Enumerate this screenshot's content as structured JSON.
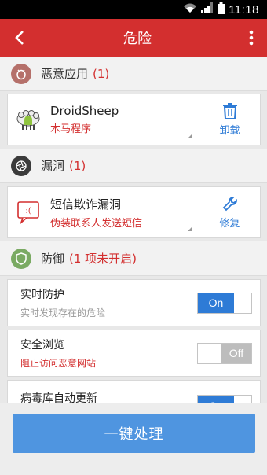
{
  "status_bar": {
    "time": "11:18"
  },
  "app_bar": {
    "title": "危险"
  },
  "malware": {
    "header_label": "恶意应用",
    "header_count": "(1)",
    "item": {
      "name": "DroidSheep",
      "type": "木马程序",
      "action_label": "卸载"
    }
  },
  "vuln": {
    "header_label": "漏洞",
    "header_count": "(1)",
    "item": {
      "name": "短信欺诈漏洞",
      "desc": "伪装联系人发送短信",
      "action_label": "修复"
    }
  },
  "defense": {
    "header_label": "防御",
    "header_count": "(1 项未开启)",
    "settings": [
      {
        "title": "实时防护",
        "desc": "实时发现存在的危险",
        "toggle": "On"
      },
      {
        "title": "安全浏览",
        "desc": "阻止访问恶意网站",
        "toggle": "Off"
      },
      {
        "title": "病毒库自动更新",
        "toggle": "On"
      }
    ]
  },
  "action_button": {
    "label": "一键处理"
  },
  "colors": {
    "accent_red": "#d32f2f",
    "accent_blue": "#2e7bd6"
  }
}
